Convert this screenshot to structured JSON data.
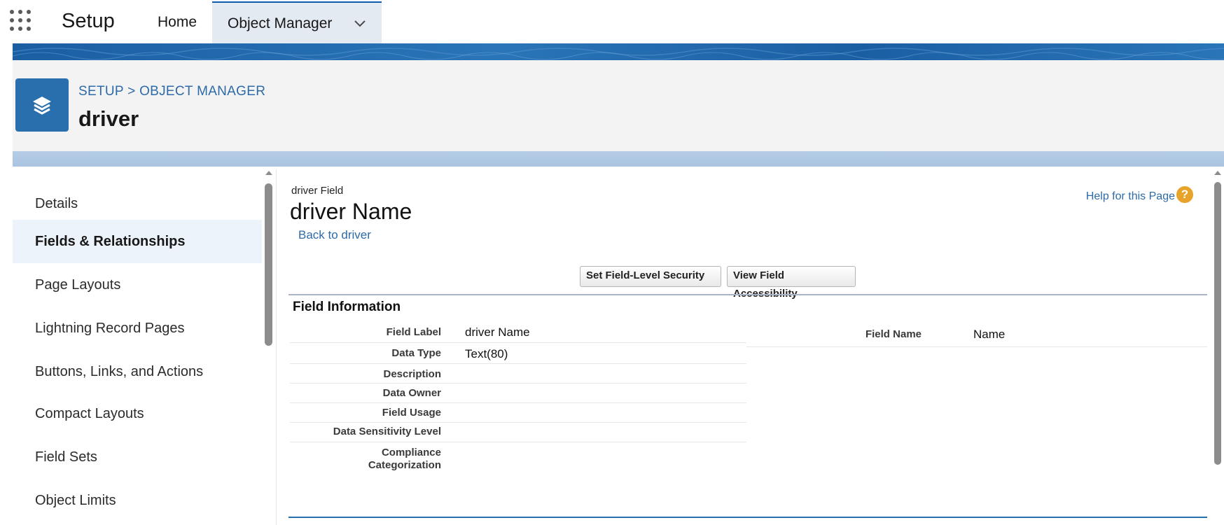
{
  "topbar": {
    "app_launcher_icon": "app-launcher-grid-icon",
    "app_name": "Setup",
    "tabs": [
      {
        "label": "Home"
      },
      {
        "label": "Object Manager",
        "icon": "chevron-down-icon"
      }
    ]
  },
  "header": {
    "object_icon": "layers-icon",
    "breadcrumb": {
      "part1": "SETUP",
      "separator": " > ",
      "part2": "OBJECT MANAGER"
    },
    "title": "driver"
  },
  "sidebar": {
    "items": [
      {
        "label": "Details",
        "active": false
      },
      {
        "label": "Fields & Relationships",
        "active": true
      },
      {
        "label": "Page Layouts",
        "active": false
      },
      {
        "label": "Lightning Record Pages",
        "active": false
      },
      {
        "label": "Buttons, Links, and Actions",
        "active": false
      },
      {
        "label": "Compact Layouts",
        "active": false
      },
      {
        "label": "Field Sets",
        "active": false
      },
      {
        "label": "Object Limits",
        "active": false
      }
    ]
  },
  "main": {
    "entity_type": "driver Field",
    "record_title": "driver Name",
    "back_link": "Back to driver",
    "help_link": "Help for this Page",
    "help_icon": "?",
    "buttons": {
      "field_level_security": "Set Field-Level Security",
      "view_field_accessibility": "View Field Accessibility"
    },
    "section_title": "Field Information",
    "fields": [
      {
        "label": "Field Label",
        "value": "driver Name"
      },
      {
        "label": "Data Type",
        "value": "Text(80)"
      },
      {
        "label": "Description",
        "value": ""
      },
      {
        "label": "Data Owner",
        "value": ""
      },
      {
        "label": "Field Usage",
        "value": ""
      },
      {
        "label": "Data Sensitivity Level",
        "value": ""
      },
      {
        "label": "Compliance Categorization",
        "value": ""
      }
    ],
    "right_fields": [
      {
        "label": "Field Name",
        "value": "Name"
      }
    ]
  },
  "colors": {
    "brand_blue": "#2a6fad",
    "link_blue": "#2d6aa8",
    "header_bg": "#f3f3f3",
    "active_nav_bg": "#edf3fb",
    "help_orange": "#e8a32b"
  }
}
